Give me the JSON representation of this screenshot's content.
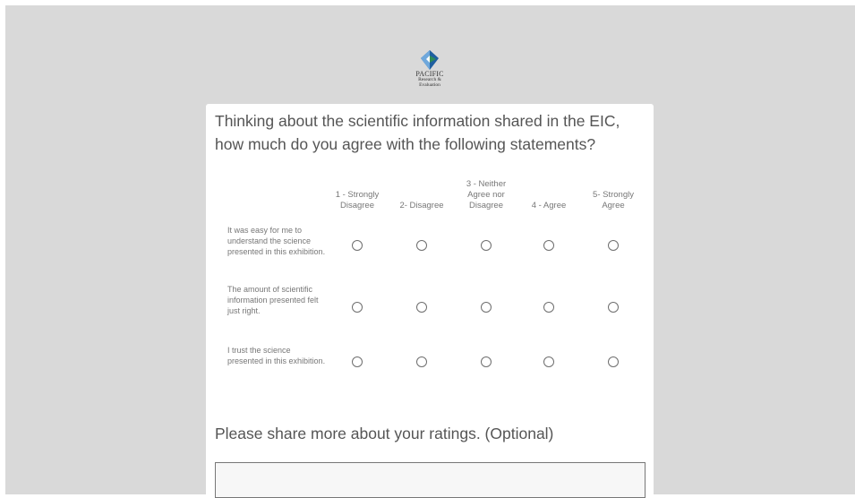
{
  "logo": {
    "line1": "PACIFIC",
    "line2": "Research &",
    "line3": "Evaluation"
  },
  "questions": {
    "matrix_title": "Thinking about the scientific information shared in the EIC, how much do you agree with the following statements?",
    "scale": [
      "1 - Strongly Disagree",
      "2- Disagree",
      "3 - Neither Agree nor Disagree",
      "4 - Agree",
      "5- Strongly Agree"
    ],
    "statements": [
      "It was easy for me to understand the science presented in this exhibition.",
      "The amount of scientific information presented felt just right.",
      "I trust the science presented in this exhibition."
    ],
    "open_title": "Please share more about your ratings. (Optional)",
    "open_value": ""
  },
  "colors": {
    "page_background": "#d9d9d9",
    "card": "#ffffff",
    "text": "#555555",
    "logo_blue": "#1f5fa0",
    "logo_green": "#2e8b57"
  },
  "icons": {
    "logo": "pacific-logo-icon",
    "radio": "radio-unselected-icon"
  }
}
